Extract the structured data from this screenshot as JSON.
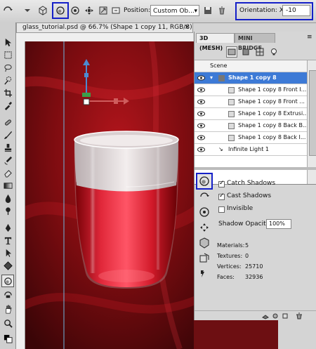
{
  "options_bar": {
    "position_label": "Position:",
    "position_value": "Custom Ob...",
    "orientation_label": "Orientation:",
    "orientation_x_label": "X:",
    "orientation_x_value": "-10",
    "highlight_color": "#1520c8"
  },
  "document": {
    "tab_title": "glass_tutorial.psd @ 66.7% (Shape 1 copy 11, RGB/8) *",
    "close_symbol": "×",
    "background_color": "#7a0d10"
  },
  "panel": {
    "tabs": [
      "3D (MESH)",
      "MINI BRIDGE"
    ],
    "menu_symbol": "≡",
    "scene_label": "Scene",
    "items": [
      {
        "label": "Shape 1 copy 8",
        "selected": true
      },
      {
        "label": "Shape 1 copy 8 Front I..."
      },
      {
        "label": "Shape 1 copy 8 Front ..."
      },
      {
        "label": "Shape 1 copy 8 Extrusi..."
      },
      {
        "label": "Shape 1 copy 8 Back B..."
      },
      {
        "label": "Shape 1 copy 8 Back I..."
      },
      {
        "label": "Infinite Light 1"
      }
    ],
    "properties": {
      "catch_shadows": "Catch Shadows",
      "cast_shadows": "Cast Shadows",
      "invisible": "Invisible",
      "shadow_opacity_label": "Shadow Opacity:",
      "shadow_opacity_value": "100%"
    },
    "stats": {
      "materials_label": "Materials:",
      "materials_value": "5",
      "textures_label": "Textures:",
      "textures_value": "0",
      "vertices_label": "Vertices:",
      "vertices_value": "25710",
      "faces_label": "Faces:",
      "faces_value": "32936"
    },
    "selection_color": "#3d7ad6"
  }
}
